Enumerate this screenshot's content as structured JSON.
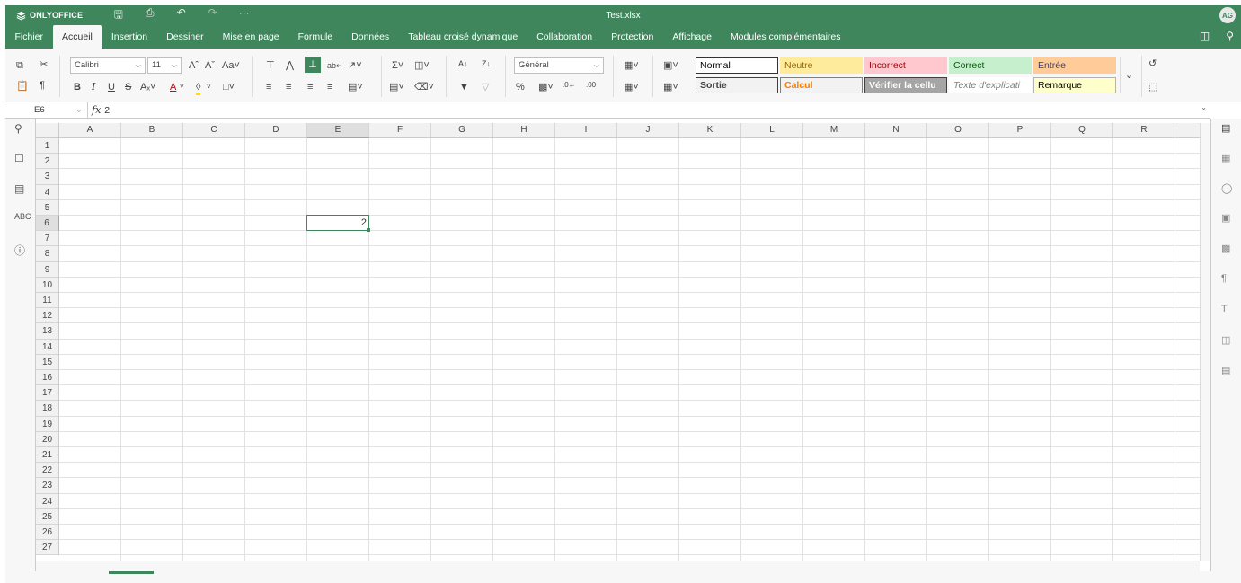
{
  "app": {
    "brand": "ONLYOFFICE",
    "doc_title": "Test.xlsx",
    "user_initials": "AG"
  },
  "tabs": [
    {
      "label": "Fichier"
    },
    {
      "label": "Accueil",
      "active": true
    },
    {
      "label": "Insertion"
    },
    {
      "label": "Dessiner"
    },
    {
      "label": "Mise en page"
    },
    {
      "label": "Formule"
    },
    {
      "label": "Données"
    },
    {
      "label": "Tableau croisé dynamique"
    },
    {
      "label": "Collaboration"
    },
    {
      "label": "Protection"
    },
    {
      "label": "Affichage"
    },
    {
      "label": "Modules complémentaires"
    }
  ],
  "toolbar": {
    "font_name": "Calibri",
    "font_size": "11",
    "number_format": "Général",
    "styles": [
      {
        "label": "Normal",
        "bg": "#ffffff",
        "fg": "#000000",
        "border": "#333333"
      },
      {
        "label": "Neutre",
        "bg": "#ffeb9c",
        "fg": "#9c6500",
        "border": "#ffeb9c"
      },
      {
        "label": "Incorrect",
        "bg": "#ffc7ce",
        "fg": "#9c0006",
        "border": "#ffc7ce"
      },
      {
        "label": "Correct",
        "bg": "#c6efce",
        "fg": "#006100",
        "border": "#c6efce"
      },
      {
        "label": "Entrée",
        "bg": "#ffcc99",
        "fg": "#3f3f76",
        "border": "#ffcc99"
      },
      {
        "label": "Sortie",
        "bg": "#f2f2f2",
        "fg": "#3f3f3f",
        "border": "#3f3f3f"
      },
      {
        "label": "Calcul",
        "bg": "#f2f2f2",
        "fg": "#fa7d00",
        "border": "#7f7f7f"
      },
      {
        "label": "Vérifier la cellu",
        "bg": "#a5a5a5",
        "fg": "#ffffff",
        "border": "#3f3f3f"
      },
      {
        "label": "Texte d'explicati",
        "bg": "#ffffff",
        "fg": "#7f7f7f",
        "border": "#ffffff"
      },
      {
        "label": "Remarque",
        "bg": "#ffffcc",
        "fg": "#000000",
        "border": "#b2b2b2"
      }
    ]
  },
  "formula_bar": {
    "name_box": "E6",
    "fx": "fx",
    "value": "2"
  },
  "grid": {
    "columns": [
      "A",
      "B",
      "C",
      "D",
      "E",
      "F",
      "G",
      "H",
      "I",
      "J",
      "K",
      "L",
      "M",
      "N",
      "O",
      "P",
      "Q",
      "R"
    ],
    "rows": [
      "1",
      "2",
      "3",
      "4",
      "5",
      "6",
      "7",
      "8",
      "9",
      "10",
      "11",
      "12",
      "13",
      "14",
      "15",
      "16",
      "17",
      "18",
      "19",
      "20",
      "21",
      "22",
      "23",
      "24",
      "25",
      "26",
      "27"
    ],
    "selected_column": "E",
    "selected_row": "6",
    "cells": [
      {
        "ref": "E6",
        "value": "2"
      }
    ]
  },
  "colors": {
    "accent": "#40865c",
    "header_bg": "#f1f1f1",
    "toolbar_bg": "#f7f7f7"
  }
}
